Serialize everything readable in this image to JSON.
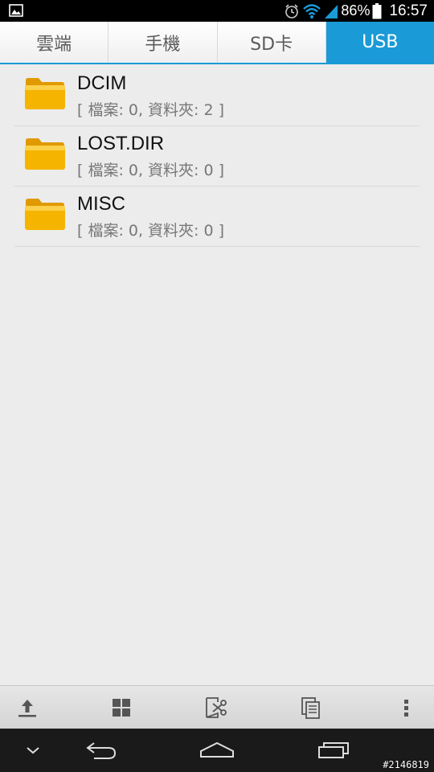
{
  "status_bar": {
    "battery": "86%",
    "time": "16:57"
  },
  "tabs": [
    {
      "label": "雲端",
      "active": false
    },
    {
      "label": "手機",
      "active": false
    },
    {
      "label": "SD卡",
      "active": false
    },
    {
      "label": "USB",
      "active": true
    }
  ],
  "files": [
    {
      "name": "DCIM",
      "meta": "[ 檔案: 0, 資料夾: 2 ]",
      "icon": "folder-icon"
    },
    {
      "name": "LOST.DIR",
      "meta": "[ 檔案: 0, 資料夾: 0 ]",
      "icon": "folder-icon"
    },
    {
      "name": "MISC",
      "meta": "[ 檔案: 0, 資料夾: 0 ]",
      "icon": "folder-icon"
    }
  ],
  "toolbar": {
    "icons": [
      "upload-icon",
      "grid-icon",
      "cut-icon",
      "copy-icon",
      "overflow-menu-icon"
    ]
  },
  "nav_bar": {
    "icons": [
      "hide-keyboard-icon",
      "back-icon",
      "home-icon",
      "recent-apps-icon"
    ]
  },
  "watermark": "#2146819",
  "colors": {
    "accent": "#1a9ad6",
    "folder": "#f5b400"
  }
}
